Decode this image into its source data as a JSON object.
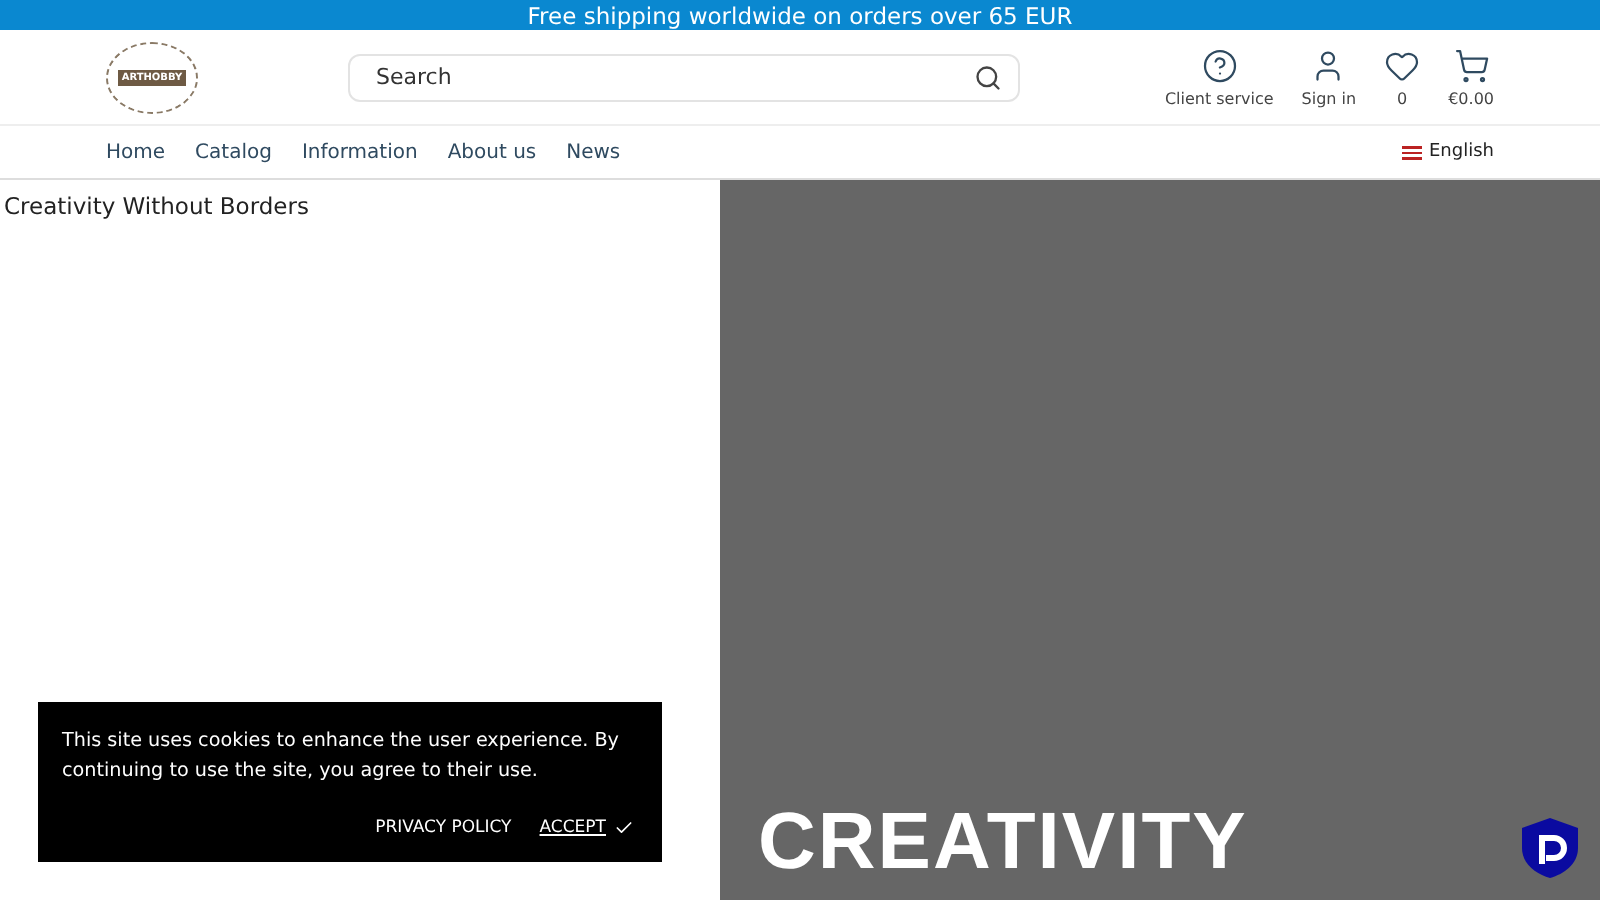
{
  "announcement": "Free shipping worldwide on orders over 65 EUR",
  "header": {
    "logo_text": "ARTHOBBY",
    "search": {
      "placeholder": "Search"
    },
    "actions": [
      {
        "kind": "help",
        "label": "Client service"
      },
      {
        "kind": "account",
        "label": "Sign in"
      },
      {
        "kind": "wishlist",
        "label": "0"
      },
      {
        "kind": "cart",
        "label": "€0.00"
      }
    ]
  },
  "nav": {
    "items": [
      "Home",
      "Catalog",
      "Information",
      "About us",
      "News"
    ],
    "language": "English"
  },
  "hero": {
    "caption": "Creativity Without Borders",
    "heading": "CREATIVITY"
  },
  "cookie_banner": {
    "message": "This site uses cookies to enhance the user experience. By continuing to use the site, you agree to their use.",
    "policy_link": "PRIVACY POLICY",
    "accept": "ACCEPT"
  }
}
